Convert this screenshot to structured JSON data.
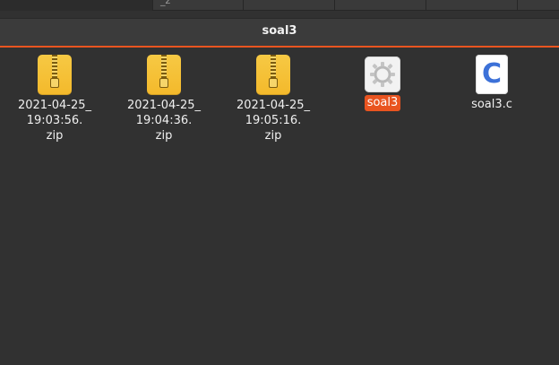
{
  "window": {
    "location_title": "soal3",
    "accent_color": "#e95420",
    "background_color": "#313131"
  },
  "top_strip": {
    "tab_fragment": "_z "
  },
  "files": [
    {
      "name_lines": [
        "2021-04-25_",
        "19:03:56.",
        "zip"
      ],
      "type_icon": "zip-archive-icon",
      "selected": false
    },
    {
      "name_lines": [
        "2021-04-25_",
        "19:04:36.",
        "zip"
      ],
      "type_icon": "zip-archive-icon",
      "selected": false
    },
    {
      "name_lines": [
        "2021-04-25_",
        "19:05:16.",
        "zip"
      ],
      "type_icon": "zip-archive-icon",
      "selected": false
    },
    {
      "name_lines": [
        "soal3"
      ],
      "type_icon": "executable-gear-icon",
      "selected": true
    },
    {
      "name_lines": [
        "soal3.c"
      ],
      "type_icon": "c-source-icon",
      "icon_letter": "C",
      "selected": false
    }
  ]
}
